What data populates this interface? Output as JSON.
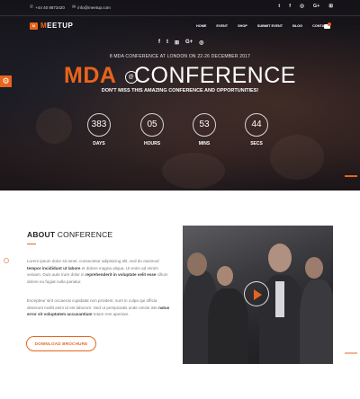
{
  "topbar": {
    "phone": "+44 40 8873420",
    "email": "info@meetup.com",
    "social": [
      "t",
      "f",
      "◎",
      "G+",
      "⊞"
    ]
  },
  "logo": {
    "first": "M",
    "rest": "EETUP",
    "badge": "M"
  },
  "nav": [
    "HOME",
    "EVENT",
    "SHOP",
    "SUBMIT EVENT",
    "BLOG",
    "CONTACT"
  ],
  "hero": {
    "social": [
      "f",
      "t",
      "⊞",
      "G+",
      "◎"
    ],
    "subtitle": "8 MDA CONFERENCE AT LONDON ON 22-26 DECEMBER 2017",
    "title_accent": "MDA",
    "title_at": "@",
    "title_rest": "CONFERENCE",
    "tagline": "DON'T MISS THIS AMAZING CONFERENCE AND OPPORTUNITIES!",
    "countdown": [
      {
        "value": "383",
        "label": "DAYS"
      },
      {
        "value": "05",
        "label": "HOURS"
      },
      {
        "value": "53",
        "label": "MINS"
      },
      {
        "value": "44",
        "label": "SECS"
      }
    ]
  },
  "about": {
    "title_bold": "ABOUT",
    "title_rest": " CONFERENCE",
    "p1_a": "Lorem ipsum dolor sit amet, consectetur adipisicing elit, sed do eiusmod ",
    "p1_b": "tempor incididunt ut labore",
    "p1_c": " et dolore magna aliqua. Ut enim ad minim veniam. Duis aute irure dolor in ",
    "p1_d": "reprehenderit in voluptate velit esse",
    "p1_e": " cillum dolore eu fugiat nulla pariatur.",
    "p2_a": "Excepteur sint occaecat cupidatat non proident, sunt in culpa qui officia deserunt mollit anim id est laborum. Sed ut perspiciatis unde omnis iste ",
    "p2_b": "natus error sit voluptatem accusantium",
    "p2_c": " totam rem aperiam.",
    "button": "DOWNLOAD BROCHURE"
  },
  "colors": {
    "accent": "#e8641c"
  },
  "icons": {
    "settings": "gear-icon",
    "play": "play-icon",
    "cart": "cart-icon"
  }
}
